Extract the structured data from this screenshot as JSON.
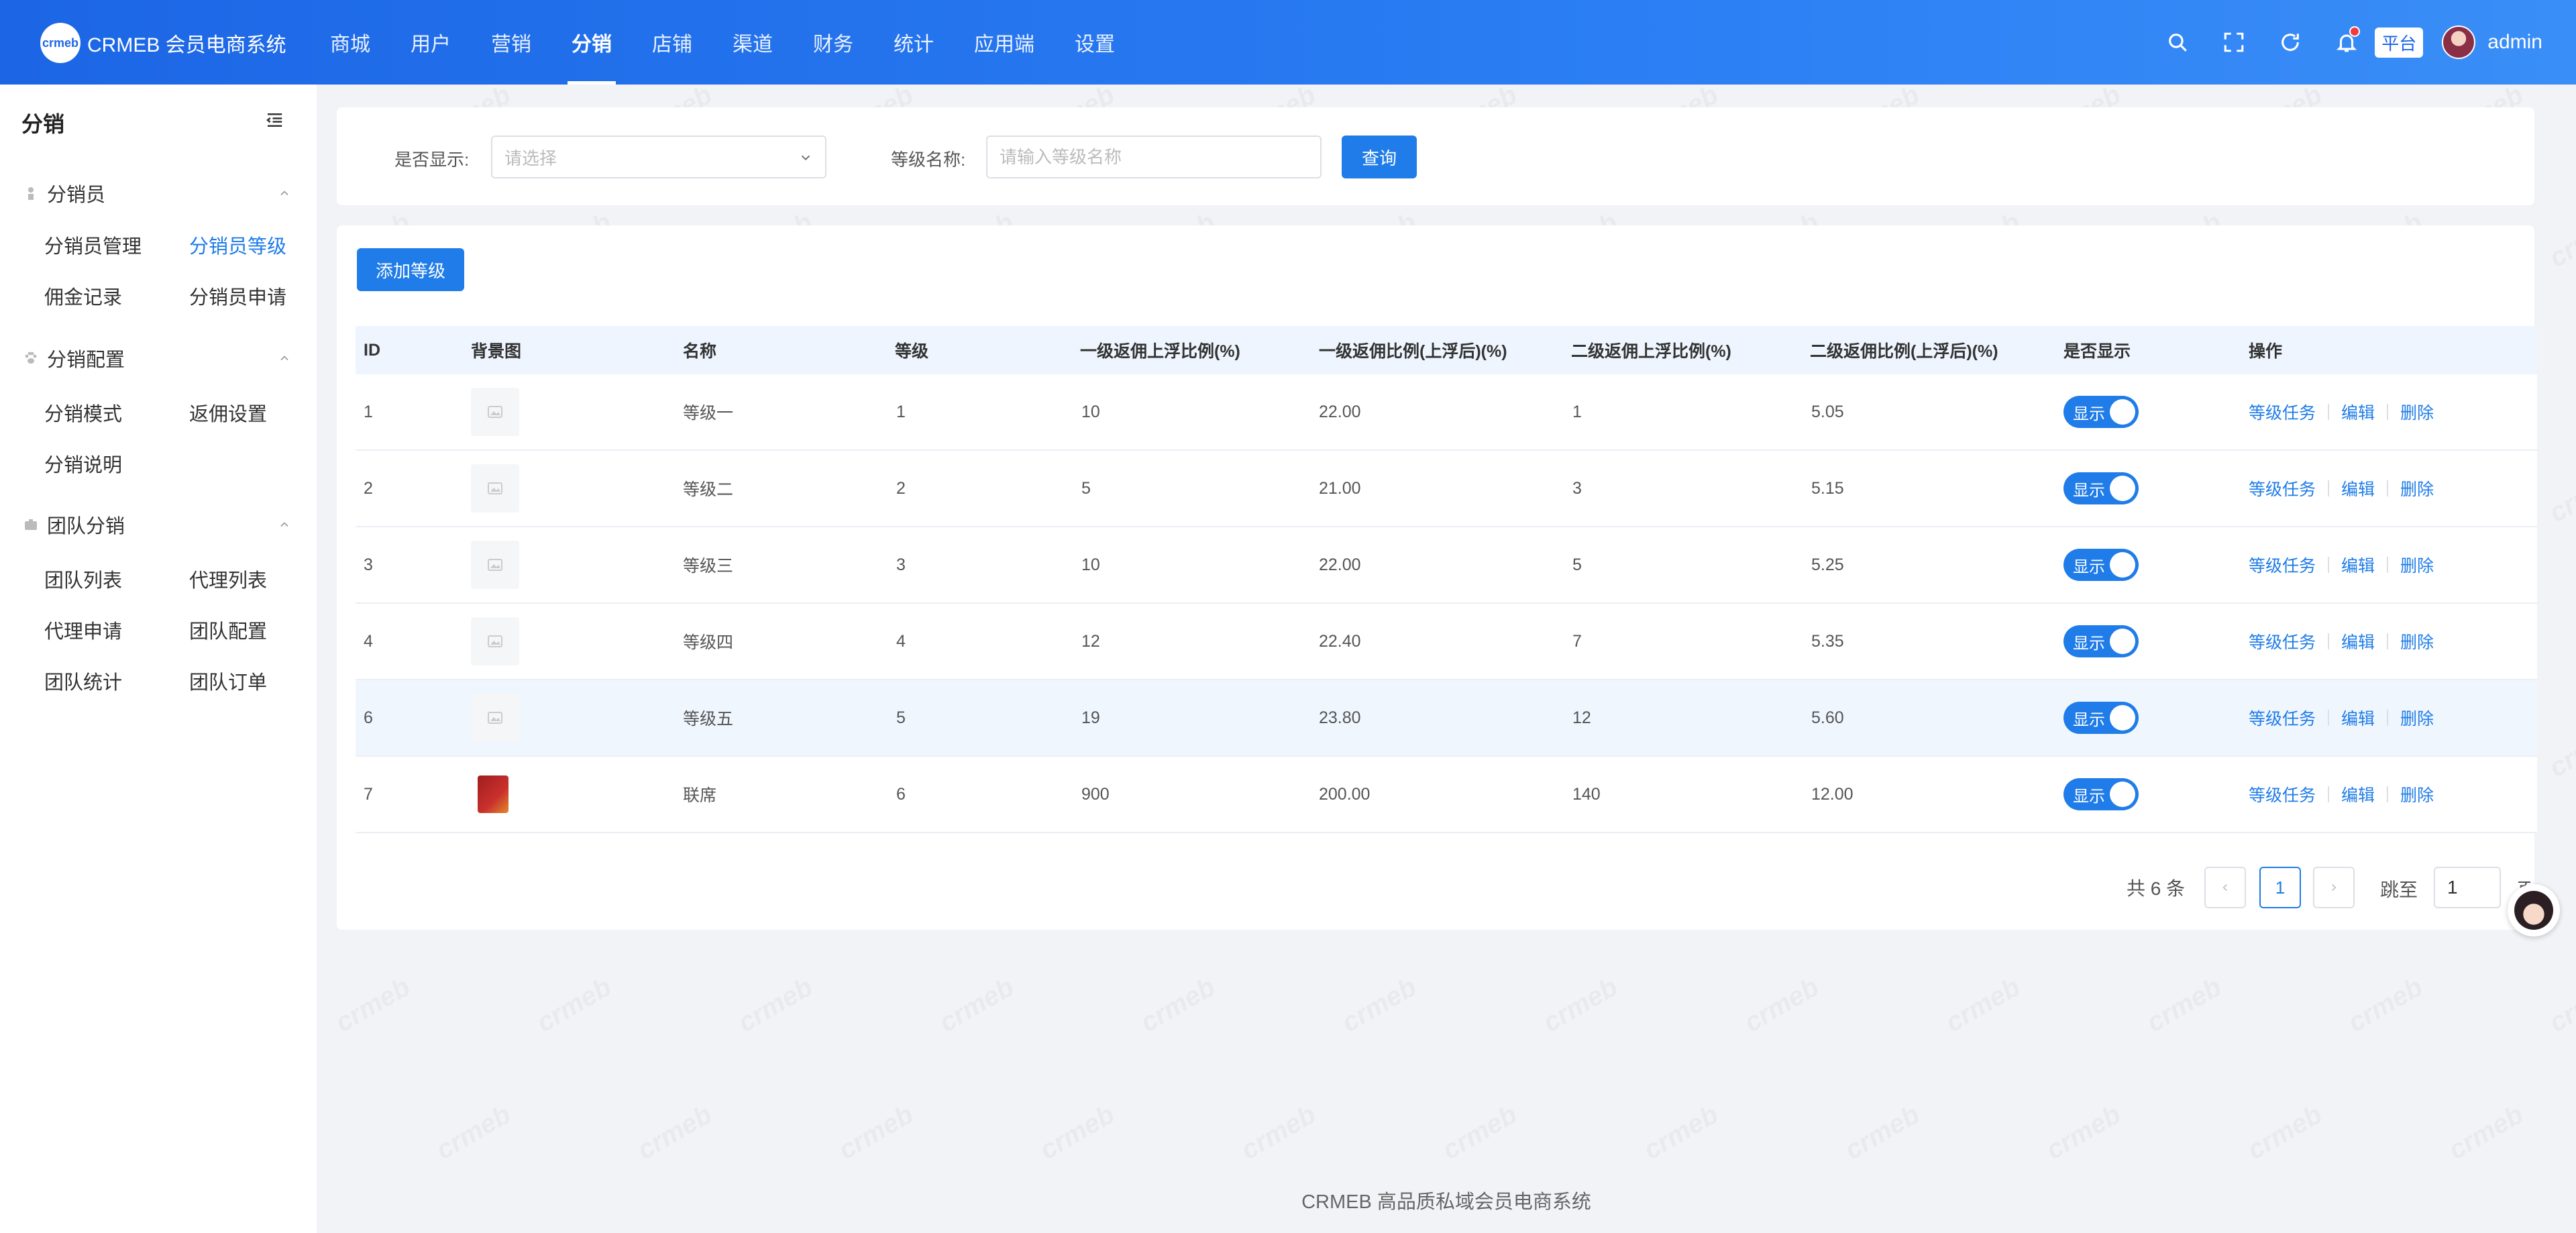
{
  "header": {
    "logo_mark": "crmeb",
    "app_title": "CRMEB 会员电商系统",
    "nav": [
      "商城",
      "用户",
      "营销",
      "分销",
      "店铺",
      "渠道",
      "财务",
      "统计",
      "应用端",
      "设置"
    ],
    "active_nav": "分销",
    "platform_badge": "平台",
    "user_name": "admin"
  },
  "sidebar": {
    "title": "分销",
    "groups": [
      {
        "label": "分销员",
        "icon": "user-icon",
        "items": [
          "分销员管理",
          "分销员等级",
          "佣金记录",
          "分销员申请"
        ]
      },
      {
        "label": "分销配置",
        "icon": "paw-icon",
        "items": [
          "分销模式",
          "返佣设置",
          "分销说明"
        ]
      },
      {
        "label": "团队分销",
        "icon": "briefcase-icon",
        "items": [
          "团队列表",
          "代理列表",
          "代理申请",
          "团队配置",
          "团队统计",
          "团队订单"
        ]
      }
    ],
    "active_item": "分销员等级"
  },
  "filters": {
    "show_label": "是否显示:",
    "show_placeholder": "请选择",
    "level_name_label": "等级名称:",
    "level_name_placeholder": "请输入等级名称",
    "query_button": "查询"
  },
  "toolbar": {
    "add_button": "添加等级"
  },
  "table": {
    "columns": [
      "ID",
      "背景图",
      "名称",
      "等级",
      "一级返佣上浮比例(%)",
      "一级返佣比例(上浮后)(%)",
      "二级返佣上浮比例(%)",
      "二级返佣比例(上浮后)(%)",
      "是否显示",
      "操作"
    ],
    "rows": [
      {
        "id": "1",
        "name": "等级一",
        "grade": "1",
        "l1_float": "10",
        "l1_rate": "22.00",
        "l2_float": "1",
        "l2_rate": "5.05",
        "show": "显示"
      },
      {
        "id": "2",
        "name": "等级二",
        "grade": "2",
        "l1_float": "5",
        "l1_rate": "21.00",
        "l2_float": "3",
        "l2_rate": "5.15",
        "show": "显示"
      },
      {
        "id": "3",
        "name": "等级三",
        "grade": "3",
        "l1_float": "10",
        "l1_rate": "22.00",
        "l2_float": "5",
        "l2_rate": "5.25",
        "show": "显示"
      },
      {
        "id": "4",
        "name": "等级四",
        "grade": "4",
        "l1_float": "12",
        "l1_rate": "22.40",
        "l2_float": "7",
        "l2_rate": "5.35",
        "show": "显示"
      },
      {
        "id": "6",
        "name": "等级五",
        "grade": "5",
        "l1_float": "19",
        "l1_rate": "23.80",
        "l2_float": "12",
        "l2_rate": "5.60",
        "show": "显示"
      },
      {
        "id": "7",
        "name": "联席",
        "grade": "6",
        "l1_float": "900",
        "l1_rate": "200.00",
        "l2_float": "140",
        "l2_rate": "12.00",
        "show": "显示"
      }
    ],
    "op_labels": [
      "等级任务",
      "编辑",
      "删除"
    ]
  },
  "pagination": {
    "total_text": "共 6 条",
    "current_page": "1",
    "jump_label": "跳至",
    "jump_value": "1",
    "jump_suffix": "页"
  },
  "footer": {
    "text": "CRMEB 高品质私域会员电商系统"
  },
  "watermark": "crmeb",
  "colors": {
    "primary": "#1f7ce8",
    "header_start": "#1c66e5",
    "header_end": "#3a8ef7",
    "row_hover": "#f0f6fe"
  }
}
